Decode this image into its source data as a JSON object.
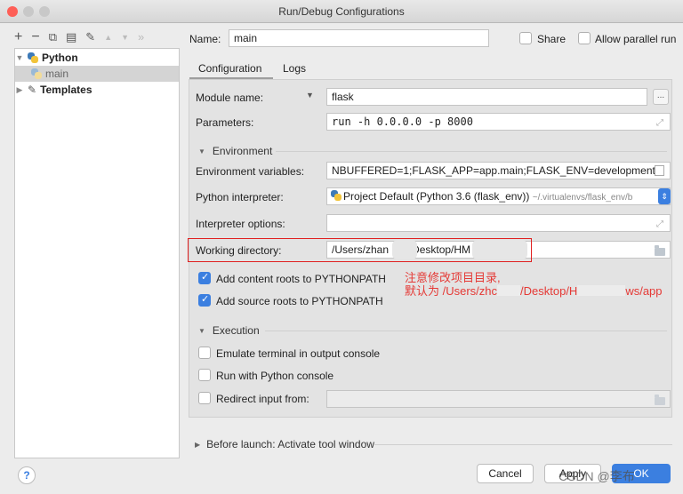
{
  "window": {
    "title": "Run/Debug Configurations"
  },
  "toolbar": {
    "icons": [
      "add-icon",
      "remove-icon",
      "copy-icon",
      "save-icon",
      "wrench-icon",
      "move-up-icon",
      "move-down-icon",
      "more-icon"
    ]
  },
  "tree": {
    "python_label": "Python",
    "main_label": "main",
    "templates_label": "Templates"
  },
  "header": {
    "name_label": "Name:",
    "name_value": "main",
    "share_label": "Share",
    "allow_parallel_label": "Allow parallel run"
  },
  "tabs": [
    {
      "label": "Configuration"
    },
    {
      "label": "Logs"
    }
  ],
  "config": {
    "module_name_label": "Module name:",
    "module_name_value": "flask",
    "module_more": "...",
    "parameters_label": "Parameters:",
    "parameters_value": "run -h 0.0.0.0 -p 8000",
    "environment_section": "Environment",
    "env_vars_label": "Environment variables:",
    "env_vars_value": "NBUFFERED=1;FLASK_APP=app.main;FLASK_ENV=development",
    "interpreter_label": "Python interpreter:",
    "interpreter_value": "Project Default (Python 3.6 (flask_env))",
    "interpreter_path": "~/.virtualenvs/flask_env/b",
    "interpreter_options_label": "Interpreter options:",
    "working_dir_label": "Working directory:",
    "working_dir_value_part1": "/Users/zhan",
    "working_dir_value_part2": "Desktop/HM",
    "add_content_roots_label": "Add content roots to PYTHONPATH",
    "add_source_roots_label": "Add source roots to PYTHONPATH",
    "execution_section": "Execution",
    "emulate_terminal_label": "Emulate terminal in output console",
    "run_python_console_label": "Run with Python console",
    "redirect_input_label": "Redirect input from:"
  },
  "annotation": {
    "line1": "注意修改项目目录,",
    "line2_a": "默认为 /Users/zhc",
    "line2_b": "/Desktop/H",
    "line2_c": "ws/app"
  },
  "before_launch": {
    "label": "Before launch: Activate tool window"
  },
  "footer": {
    "help_label": "?",
    "cancel_label": "Cancel",
    "apply_label": "Apply",
    "ok_label": "OK",
    "watermark": "CSDN @李布"
  },
  "colors": {
    "accent": "#3b7fe0",
    "annotation_red": "#e53935"
  }
}
